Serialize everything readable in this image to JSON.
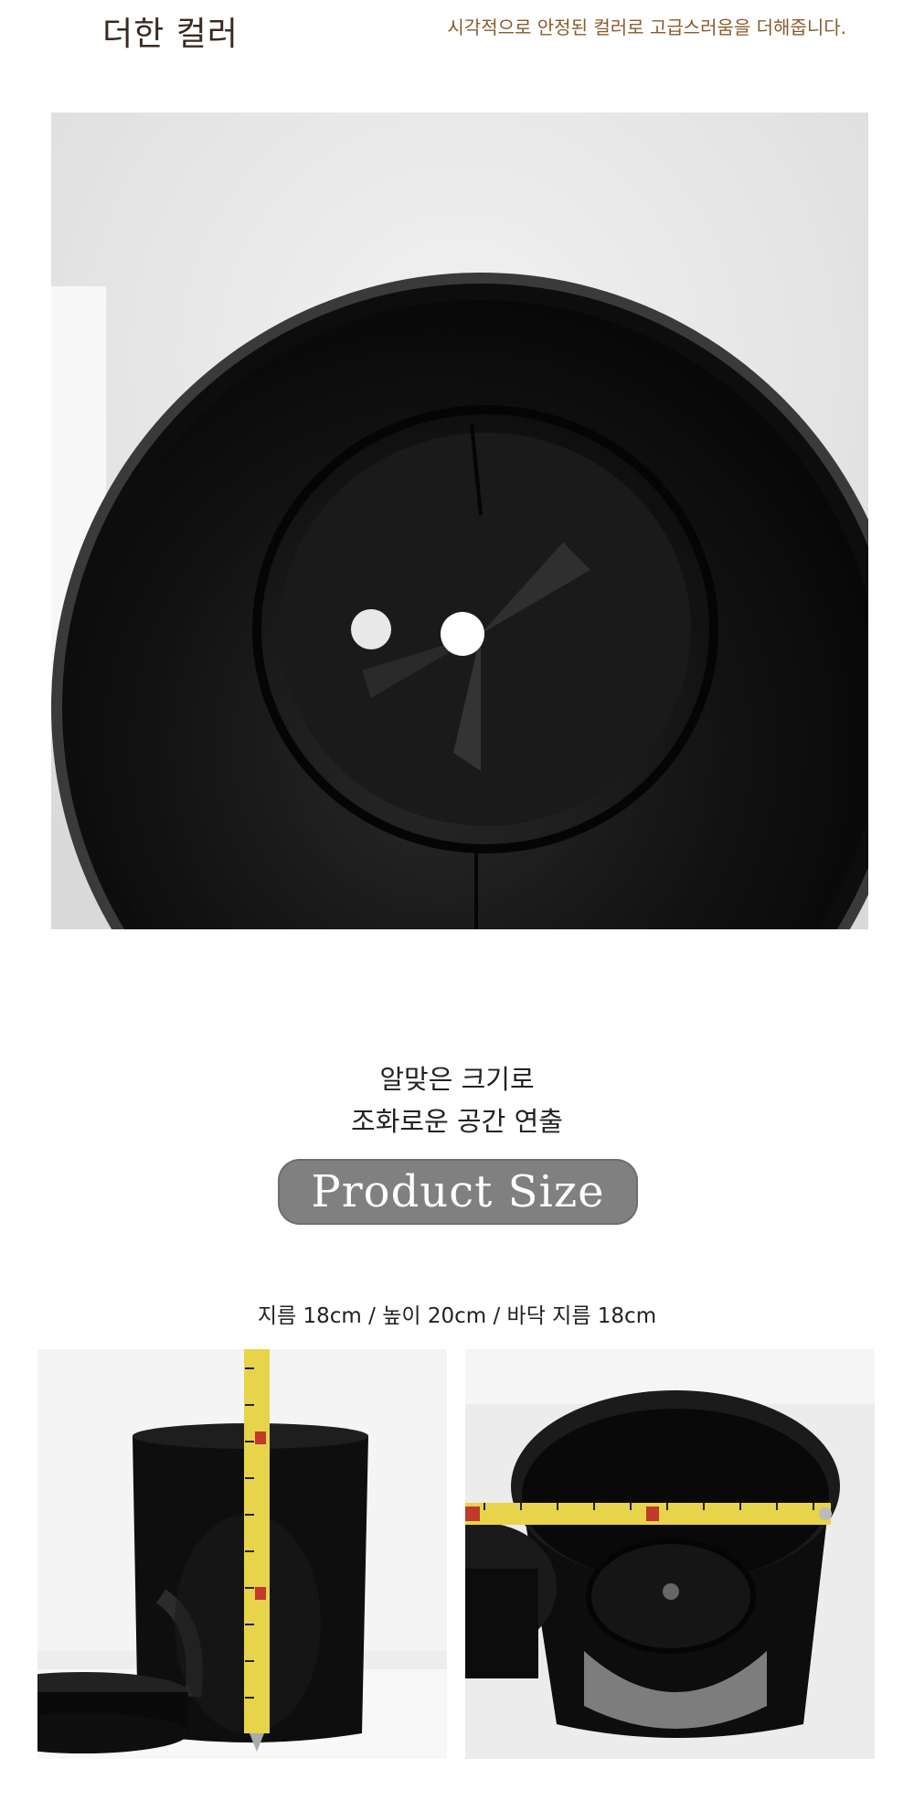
{
  "header": {
    "title": "더한 컬러",
    "description": "시각적으로 안정된 컬러로 고급스러움을 더해줍니다."
  },
  "photos": {
    "main": "bin-interior-top-view-photo",
    "left": "bin-height-measurement-photo",
    "right": "bin-diameter-measurement-photo"
  },
  "section": {
    "headline_line1": "알맞은 크기로",
    "headline_line2": "조화로운 공간 연출",
    "badge": "Product Size",
    "dimensions": "지름 18cm / 높이 20cm / 바닥 지름 18cm"
  },
  "colors": {
    "desc_text": "#8a5a2b",
    "badge_bg": "#808080",
    "bin_black": "#111111"
  }
}
